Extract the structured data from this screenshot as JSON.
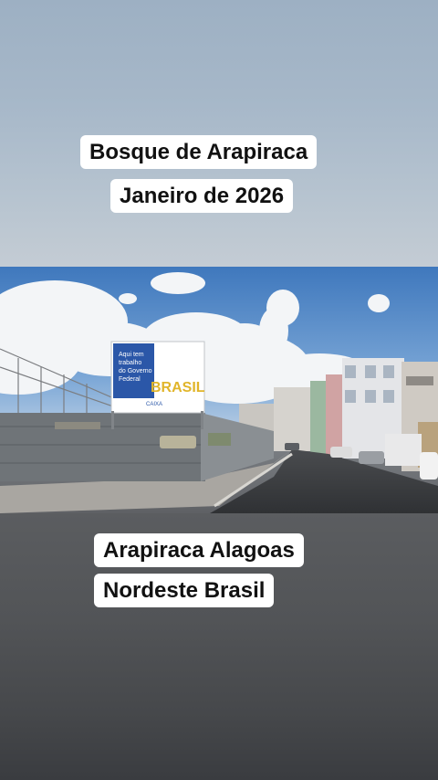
{
  "captions": {
    "title_line1": "Bosque de Arapiraca",
    "title_line2": "Janeiro de 2026",
    "location_line1": "Arapiraca Alagoas",
    "location_line2": "Nordeste Brasil"
  },
  "billboard": {
    "text_line1": "Aqui tem",
    "text_line2": "trabalho",
    "text_line3": "do Governo",
    "text_line4": "Federal",
    "brand": "BRASIL",
    "footer": "CAIXA"
  },
  "colors": {
    "sky_blue": "#4f86c6",
    "cloud": "#f3f5f7",
    "asphalt": "#3b3d40",
    "billboard_blue": "#2b57a8"
  }
}
